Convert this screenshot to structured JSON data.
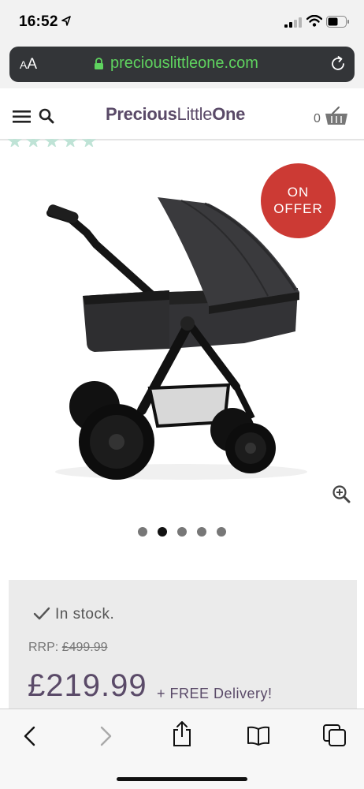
{
  "status_bar": {
    "time": "16:52"
  },
  "browser": {
    "aa_label_small": "A",
    "aa_label_large": "A",
    "url": "preciouslittleone.com"
  },
  "site_header": {
    "logo_bold": "Precious",
    "logo_light": "Little",
    "logo_bold2": "One",
    "cart_count": "0"
  },
  "product": {
    "badge_line1": "ON",
    "badge_line2": "OFFER",
    "gallery": {
      "total_images": 5,
      "active_index": 2
    }
  },
  "purchase": {
    "stock_text": "In stock.",
    "rrp_label": "RRP:",
    "rrp_price": "£499.99",
    "price": "£219.99",
    "delivery_text": "+ FREE Delivery!"
  },
  "colors": {
    "brand_purple": "#5a4a68",
    "offer_red": "#cc3a34",
    "url_green": "#5fd35f"
  },
  "icons": [
    "location-arrow-icon",
    "cell-signal-icon",
    "wifi-icon",
    "battery-icon",
    "lock-icon",
    "reload-icon",
    "menu-icon",
    "search-icon",
    "basket-icon",
    "zoom-in-icon",
    "check-icon",
    "back-icon",
    "forward-icon",
    "share-icon",
    "bookmarks-icon",
    "tabs-icon"
  ]
}
